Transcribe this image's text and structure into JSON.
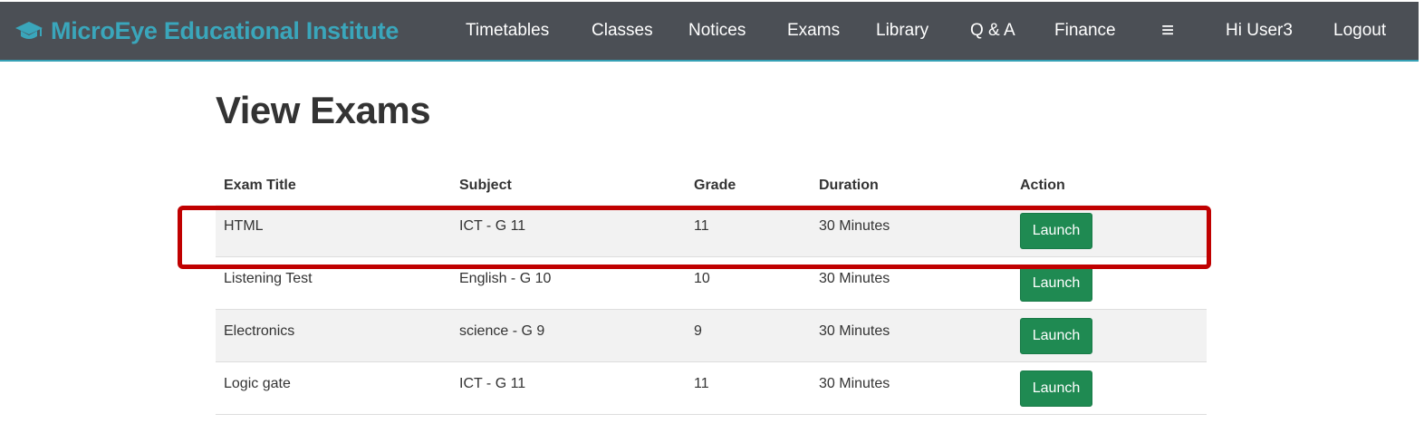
{
  "header": {
    "brand": "MicroEye Educational Institute",
    "nav": [
      "Timetables",
      "Classes",
      "Notices",
      "Exams",
      "Library",
      "Q & A",
      "Finance"
    ],
    "menu_icon": "≡",
    "greeting": "Hi User3",
    "logout": "Logout"
  },
  "page": {
    "title": "View Exams"
  },
  "table": {
    "headers": [
      "Exam Title",
      "Subject",
      "Grade",
      "Duration",
      "Action"
    ],
    "rows": [
      {
        "title": "HTML",
        "subject": "ICT - G 11",
        "grade": "11",
        "duration": "30 Minutes",
        "action": "Launch"
      },
      {
        "title": "Listening Test",
        "subject": "English - G 10",
        "grade": "10",
        "duration": "30 Minutes",
        "action": "Launch"
      },
      {
        "title": "Electronics",
        "subject": "science - G 9",
        "grade": "9",
        "duration": "30 Minutes",
        "action": "Launch"
      },
      {
        "title": "Logic gate",
        "subject": "ICT - G 11",
        "grade": "11",
        "duration": "30 Minutes",
        "action": "Launch"
      }
    ]
  },
  "colors": {
    "navbar": "#4b4f55",
    "brand": "#3aa6bb",
    "button": "#1f8a52",
    "highlight": "#c00000"
  }
}
